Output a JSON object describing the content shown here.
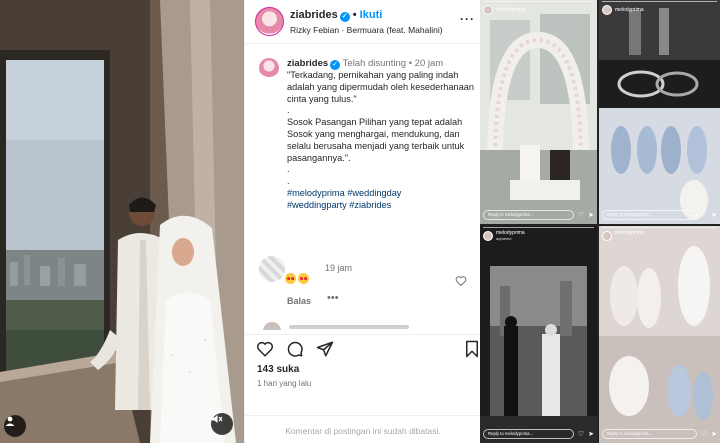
{
  "post": {
    "username": "ziabrides",
    "follow_label": "Ikuti",
    "music": "Rizky Febian · Bermuara (feat. Mahalini)",
    "caption_user": "ziabrides",
    "caption_status": "Telah disunting",
    "caption_time": "20 jam",
    "caption_text": "\"Terkadang, pernikahan yang paling indah adalah yang dipermudah oleh kesederhanaan cinta yang tulus.\"\n.\nSosok Pasangan Pilihan yang tepat adalah\nSosok yang menghargai, mendukung, dan selalu berusaha menjadi yang terbaik untuk pasangannya.\".\n.\n.",
    "hashtags": "#weddingparty #ziabrides",
    "hashtags_line1": "#melodyprima #weddingday",
    "comment_time": "19 jam",
    "comment_reply": "Balas",
    "comment_more": "•••",
    "likes": "143 suka",
    "date": "1 hari yang lalu",
    "limited_notice": "Komentar di postingan ini sudah dibatasi."
  },
  "stories": [
    {
      "user": "melodyprima",
      "sub": "",
      "reply": "Reply to melodyprima...",
      "tone": "#cfd4cf"
    },
    {
      "user": "melodyprima",
      "sub": "",
      "reply": "Reply to melodyprima...",
      "tone": "#2e2e2e"
    },
    {
      "user": "melodyprima",
      "sub": "aqmeme",
      "reply": "Reply to melodyprima...",
      "tone": "#2b2b2b"
    },
    {
      "user": "melodyprima",
      "sub": "Tunggu",
      "reply": "Reply to melodyprima...",
      "tone": "#c9c3c1"
    }
  ],
  "colors": {
    "accent": "#0095f6",
    "hashtag": "#00376b",
    "muted": "#737373"
  }
}
